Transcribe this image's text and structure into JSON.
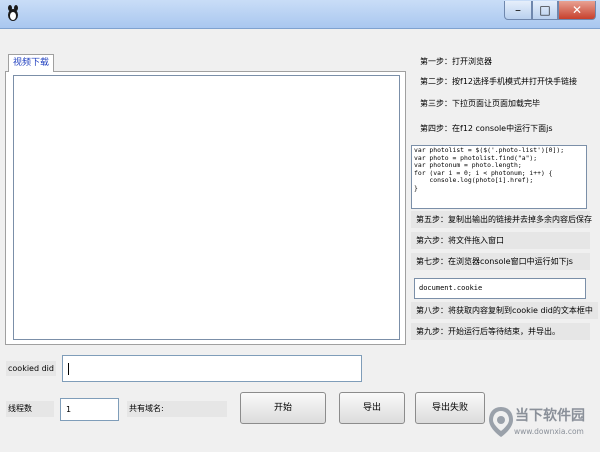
{
  "window": {
    "title": "",
    "min_glyph": "–",
    "max_glyph": "□",
    "close_glyph": "✕",
    "icon": "app-logo-icon"
  },
  "tab": {
    "label": "视频下载"
  },
  "steps": [
    "第一步：打开浏览器",
    "第二步：按f12选择手机模式并打开快手链接",
    "第三步：下拉页面让页面加载完毕",
    "第四步：在f12 console中运行下面js"
  ],
  "code": "var photolist = $($('.photo-list')[0]);\nvar photo = photolist.find(\"a\");\nvar photonum = photo.length;\nfor (var i = 0; i < photonum; i++) {\n    console.log(photo[i].href);\n}",
  "steps2": [
    "第五步：复制出输出的链接并去掉多余内容后保存",
    "第六步：将文件拖入窗口",
    "第七步：在浏览器console窗口中运行如下js"
  ],
  "cookie_code": "document.cookie",
  "steps3": [
    "第八步：将获取内容复制到cookie did的文本框中",
    "第九步：开始运行后等待结束，并导出。"
  ],
  "form": {
    "cookie_label": "cookied did",
    "cookie_value": "",
    "thread_label": "线程数",
    "thread_value": "1",
    "domain_label": "共有域名:"
  },
  "buttons": {
    "start": "开始",
    "export": "导出",
    "export_failed": "导出失败"
  },
  "watermark": {
    "title": "当下软件园",
    "url": "www.downxia.com"
  },
  "colors": {
    "titlebar": "#b9d2f3",
    "tab_text": "#1f3fbf",
    "close_button": "#c7402d",
    "watermark": "#8a9099"
  }
}
